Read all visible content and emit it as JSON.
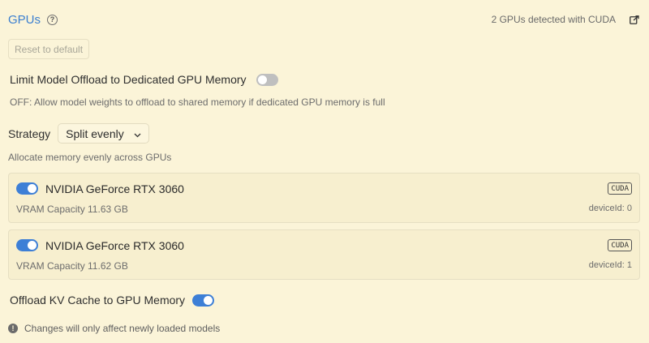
{
  "header": {
    "title": "GPUs",
    "help_icon": "?",
    "detected_text": "2 GPUs detected with CUDA"
  },
  "reset": {
    "label": "Reset to default"
  },
  "limit_offload": {
    "label": "Limit Model Offload to Dedicated GPU Memory",
    "enabled": false,
    "hint": "OFF: Allow model weights to offload to shared memory if dedicated GPU memory is full"
  },
  "strategy": {
    "label": "Strategy",
    "selected": "Split evenly",
    "hint": "Allocate memory evenly across GPUs"
  },
  "gpus": [
    {
      "name": "NVIDIA GeForce RTX 3060",
      "vram": "VRAM Capacity 11.63 GB",
      "badge": "CUDA",
      "device_id": "deviceId: 0",
      "enabled": true
    },
    {
      "name": "NVIDIA GeForce RTX 3060",
      "vram": "VRAM Capacity 11.62 GB",
      "badge": "CUDA",
      "device_id": "deviceId: 1",
      "enabled": true
    }
  ],
  "kv_cache": {
    "label": "Offload KV Cache to GPU Memory",
    "enabled": true
  },
  "footer_note": {
    "icon": "!",
    "text": "Changes will only affect newly loaded models"
  },
  "colors": {
    "accent": "#3d7fd6",
    "background": "#fbf4d8",
    "card": "#f7efcf"
  }
}
